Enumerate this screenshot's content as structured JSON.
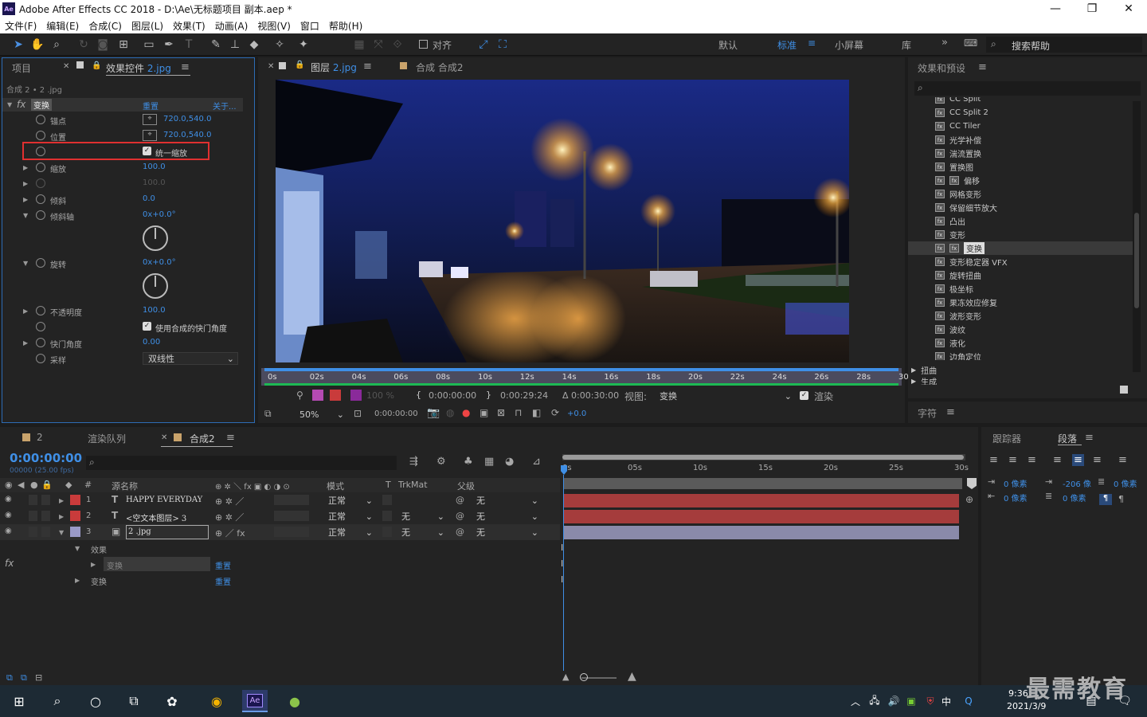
{
  "title": "Adobe After Effects CC 2018 - D:\\Ae\\无标题项目 副本.aep *",
  "menu": [
    "文件(F)",
    "编辑(E)",
    "合成(C)",
    "图层(L)",
    "效果(T)",
    "动画(A)",
    "视图(V)",
    "窗口",
    "帮助(H)"
  ],
  "toolbar": {
    "snap": "对齐",
    "workspaces": [
      "默认",
      "标准",
      "小屏幕",
      "库"
    ],
    "search_help": "搜索帮助"
  },
  "project_tab": "项目",
  "effects_tab": "效果控件",
  "effects_tab_file": "2.jpg",
  "ec_path": "合成 2 • 2 .jpg",
  "ec": {
    "effect": "变换",
    "reset": "重置",
    "about": "关于...",
    "anchor_label": "锚点",
    "anchor_val": "720.0,540.0",
    "pos_label": "位置",
    "pos_val": "720.0,540.0",
    "uniform": "统一缩放",
    "scale_label": "缩放",
    "scale_val": "100.0",
    "scale2_val": "100.0",
    "skew_label": "倾斜",
    "skew_val": "0.0",
    "skewaxis_label": "倾斜轴",
    "skewaxis_val": "0x+0.0°",
    "rot_label": "旋转",
    "rot_val": "0x+0.0°",
    "opacity_label": "不透明度",
    "opacity_val": "100.0",
    "shutter_use": "使用合成的快门角度",
    "shutter_label": "快门角度",
    "shutter_val": "0.00",
    "sample_label": "采样",
    "sample_val": "双线性"
  },
  "comp_tab_layer": "图层",
  "comp_tab_layer_file": "2.jpg",
  "comp_tab_comp": "合成 合成2",
  "ruler": [
    "0s",
    "02s",
    "04s",
    "06s",
    "08s",
    "10s",
    "12s",
    "14s",
    "16s",
    "18s",
    "20s",
    "22s",
    "24s",
    "26s",
    "28s",
    "30s"
  ],
  "viewer": {
    "opacity": "100 %",
    "t_in": "0:00:00:00",
    "t_out": "0:00:29:24",
    "t_dur": "Δ 0:00:30:00",
    "view_label": "视图:",
    "view_val": "变换",
    "render": "渲染",
    "zoom": "50%",
    "time": "0:00:00:00",
    "exposure": "+0.0"
  },
  "fxp": {
    "title": "效果和预设",
    "items": [
      "CC Split",
      "CC Split 2",
      "CC Tiler",
      "光学补偿",
      "湍流置换",
      "置换图",
      "偏移",
      "网格变形",
      "保留细节放大",
      "凸出",
      "变形",
      "变换",
      "变形稳定器 VFX",
      "旋转扭曲",
      "极坐标",
      "果冻效应修复",
      "波形变形",
      "波纹",
      "液化",
      "边角定位"
    ],
    "cats": [
      "扭曲",
      "生成"
    ]
  },
  "char_tab": "字符",
  "tl": {
    "tab_num": "2",
    "render_queue": "渲染队列",
    "comp_tab": "合成2",
    "time": "0:00:00:00",
    "fps": "00000 (25.00 fps)",
    "col_name": "源名称",
    "col_mode": "模式",
    "col_t": "T",
    "col_trk": "TrkMat",
    "col_parent": "父级",
    "layers": [
      {
        "num": "1",
        "name": "HAPPY EVERYDAY",
        "mode": "正常",
        "trk": "",
        "parent": "无"
      },
      {
        "num": "2",
        "name": "<空文本图层> 3",
        "mode": "正常",
        "trk": "无",
        "parent": "无"
      },
      {
        "num": "3",
        "name": "2 .jpg",
        "mode": "正常",
        "trk": "无",
        "parent": "无"
      }
    ],
    "effects": "效果",
    "transform_fx": "变换",
    "reset": "重置",
    "transform": "变换",
    "reset2": "重置"
  },
  "tl_ruler": [
    "0s",
    "05s",
    "10s",
    "15s",
    "20s",
    "25s",
    "30s"
  ],
  "para": {
    "tracker": "跟踪器",
    "tab": "段落",
    "indent_l": "0 像素",
    "indent_r": "0 像素",
    "first": "-206 像",
    "before": "0 像素",
    "after": "0 像素",
    "space": "0 像素"
  },
  "taskbar": {
    "time": "9:36",
    "date": "2021/3/9",
    "ime": "中"
  },
  "watermark": "最需教育"
}
